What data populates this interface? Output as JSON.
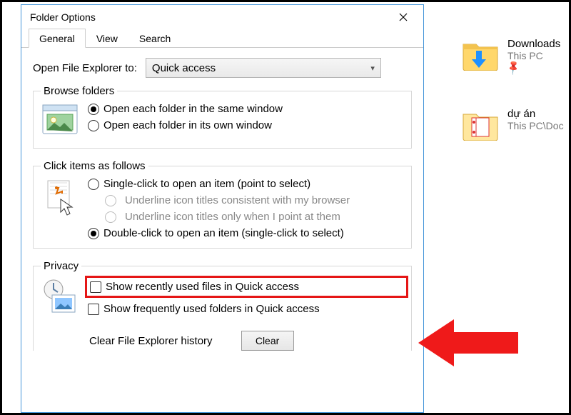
{
  "dialog": {
    "title": "Folder Options",
    "tabs": {
      "general": "General",
      "view": "View",
      "search": "Search"
    },
    "open_label": "Open File Explorer to:",
    "open_value": "Quick access",
    "browse": {
      "legend": "Browse folders",
      "same": "Open each folder in the same window",
      "own": "Open each folder in its own window"
    },
    "click": {
      "legend": "Click items as follows",
      "single": "Single-click to open an item (point to select)",
      "u1": "Underline icon titles consistent with my browser",
      "u2": "Underline icon titles only when I point at them",
      "double": "Double-click to open an item (single-click to select)"
    },
    "privacy": {
      "legend": "Privacy",
      "files": "Show recently used files in Quick access",
      "folders": "Show frequently used folders in Quick access",
      "clear_label": "Clear File Explorer history",
      "clear_btn": "Clear"
    }
  },
  "explorer": {
    "item1": {
      "name": "Downloads",
      "sub": "This PC"
    },
    "item2": {
      "name": "dự án",
      "sub": "This PC\\Doc"
    }
  }
}
